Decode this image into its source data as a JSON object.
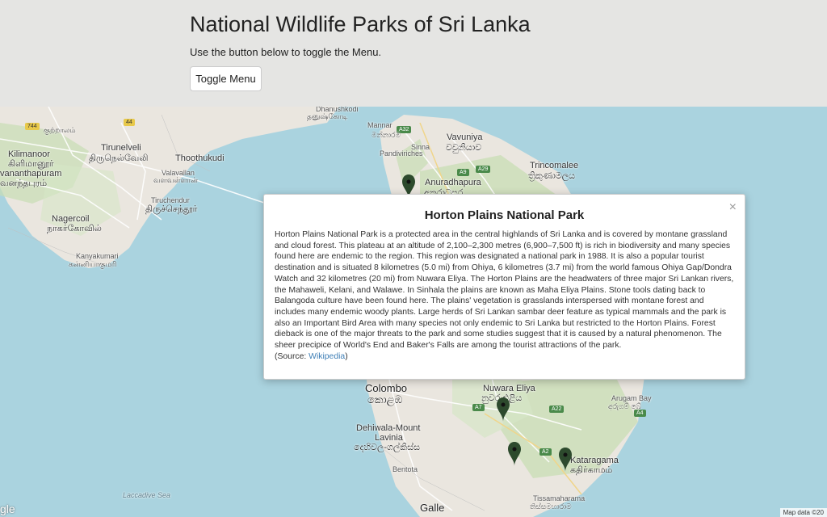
{
  "header": {
    "title": "National Wildlife Parks of Sri Lanka",
    "subtitle": "Use the button below to toggle the Menu.",
    "toggle_label": "Toggle Menu"
  },
  "map": {
    "labels": {
      "dhanushkodi": "Dhanushkodi",
      "dhanushkodi_ta": "தனுஷ்கோடி",
      "mannar": "Mannar",
      "mannar_si": "මන්නාරම",
      "vavuniya": "Vavuniya",
      "vavuniya_si": "වවුනියාව",
      "sinna": "Sinna",
      "pandiviriches": "Pandiviriches",
      "trincomalee": "Trincomalee",
      "trincomalee_si": "ත්‍රිකුණාමලය",
      "anuradhapura": "Anuradhapura",
      "anuradhapura_si": "අනුරාධපුර",
      "tirunelveli": "Tirunelveli",
      "tirunelveli_ta": "திருநெல்வேலி",
      "thoothukudi": "Thoothukudi",
      "kilimanoor": "Kilimanoor",
      "kilimanoor_ta": "கிளிமானூர்",
      "ananthapuram": "vananthapuram",
      "ananthapuram_ta": "வனந்தபுரம்",
      "valavallan": "Valavallan",
      "valavallan_ta": "வளவள்ளான்",
      "tiruchendur": "Tiruchendur",
      "tiruchendur_ta": "திருச்செந்தூர்",
      "nagercoil": "Nagercoil",
      "nagercoil_ta": "நாகர்கோவில்",
      "kanyakumari": "Kanyakumari",
      "kanyakumari_ta": "கன்னியாகுமரி",
      "kottalam": "குற்றாலம்",
      "colombo": "Colombo",
      "colombo_si": "කොළඹ",
      "dehiwala": "Dehiwala-Mount",
      "lavinia": "Lavinia",
      "lavinia_si": "දෙහිවල-ගල්කිස්ස",
      "bentota": "Bentota",
      "galle": "Galle",
      "nuwara": "Nuwara Eliya",
      "nuwara_si": "නුවර එළිය",
      "arugam": "Arugam Bay",
      "arugam_si": "අරුගම් බේ",
      "kataragama": "Kataragama",
      "kataragama_ta": "கதிர்காமம்",
      "tissamaharama": "Tissamaharama",
      "tissamaharama_si": "තිස්සමහාරාම",
      "laccadive": "Laccadive Sea"
    },
    "shields": {
      "n744": "744",
      "n44": "44",
      "a32": "A32",
      "a9": "A9",
      "a29": "A29",
      "a7": "A7",
      "a22": "A22",
      "a2": "A2",
      "a4": "A4"
    },
    "google": "gle",
    "credit": "Map data ©20"
  },
  "modal": {
    "title": "Horton Plains National Park",
    "close": "×",
    "body": "Horton Plains National Park is a protected area in the central highlands of Sri Lanka and is covered by montane grassland and cloud forest. This plateau at an altitude of 2,100–2,300 metres (6,900–7,500 ft) is rich in biodiversity and many species found here are endemic to the region. This region was designated a national park in 1988. It is also a popular tourist destination and is situated 8 kilometres (5.0 mi) from Ohiya, 6 kilometres (3.7 mi) from the world famous Ohiya Gap/Dondra Watch and 32 kilometres (20 mi) from Nuwara Eliya. The Horton Plains are the headwaters of three major Sri Lankan rivers, the Mahaweli, Kelani, and Walawe. In Sinhala the plains are known as Maha Eliya Plains. Stone tools dating back to Balangoda culture have been found here. The plains' vegetation is grasslands interspersed with montane forest and includes many endemic woody plants. Large herds of Sri Lankan sambar deer feature as typical mammals and the park is also an Important Bird Area with many species not only endemic to Sri Lanka but restricted to the Horton Plains. Forest dieback is one of the major threats to the park and some studies suggest that it is caused by a natural phenomenon. The sheer precipice of World's End and Baker's Falls are among the tourist attractions of the park.",
    "source_prefix": "(Source: ",
    "source_link": "Wikipedia",
    "source_suffix": ")"
  },
  "colors": {
    "land": "#eae6df",
    "forest": "#c8ddb4",
    "water": "#aad3df",
    "marker": "#2d4a2d"
  }
}
